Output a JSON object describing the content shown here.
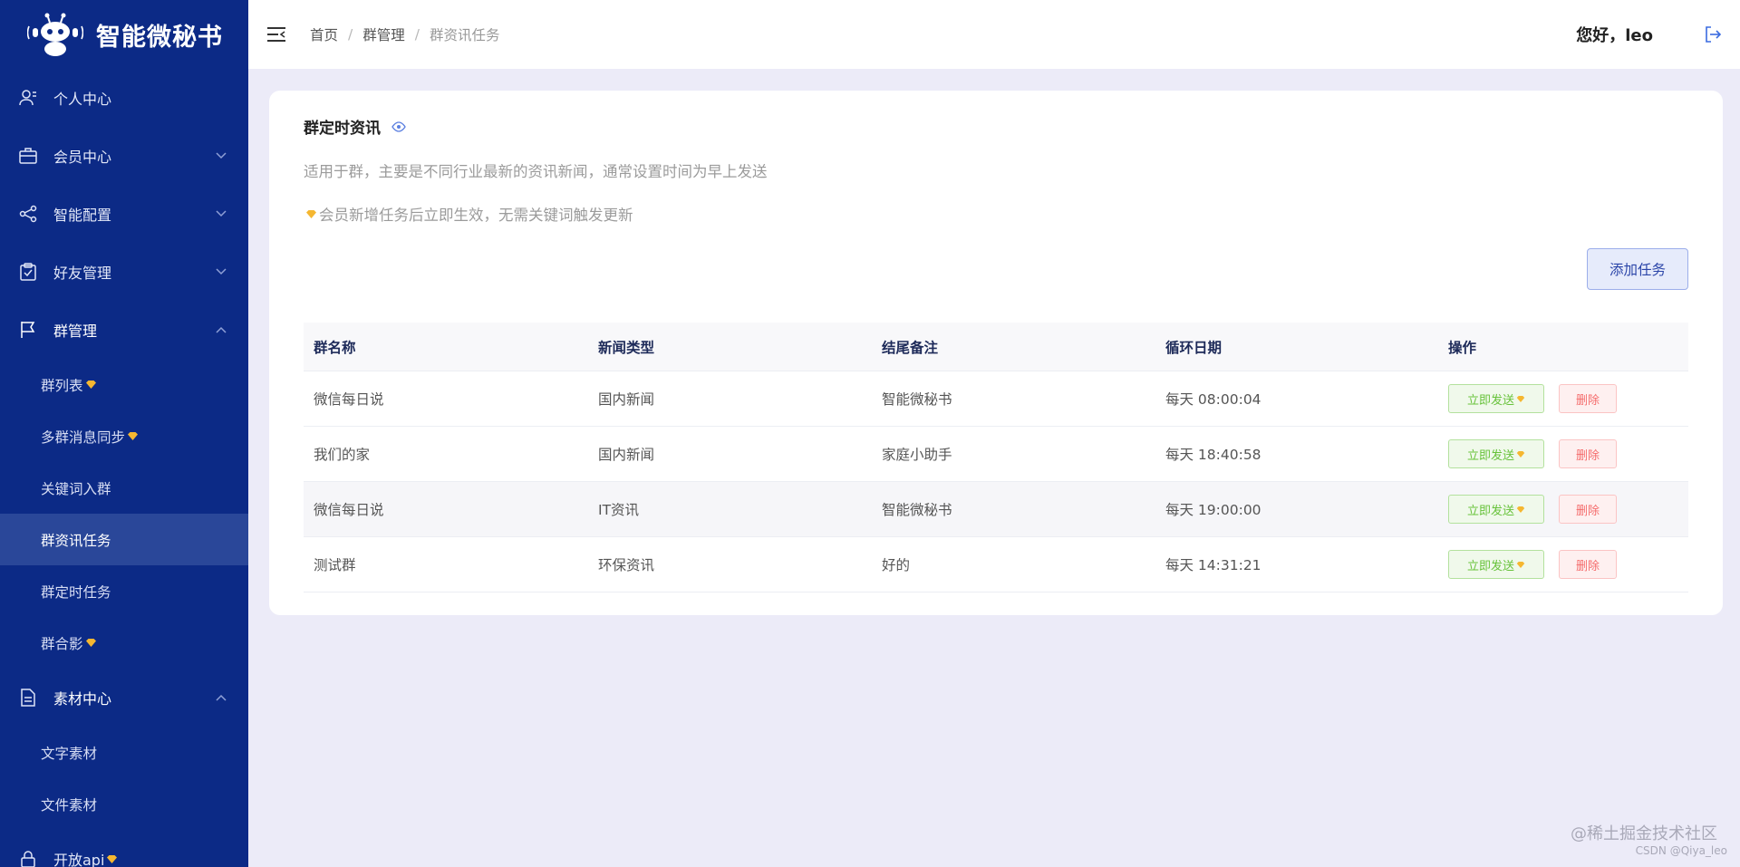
{
  "brand": {
    "name": "智能微秘书"
  },
  "sidebar": {
    "items": [
      {
        "label": "个人中心",
        "icon": "user-icon"
      },
      {
        "label": "会员中心",
        "icon": "briefcase-icon"
      },
      {
        "label": "智能配置",
        "icon": "share-icon"
      },
      {
        "label": "好友管理",
        "icon": "clipboard-check-icon"
      },
      {
        "label": "群管理",
        "icon": "flag-icon"
      }
    ],
    "group_sub": [
      {
        "label": "群列表",
        "gem": true
      },
      {
        "label": "多群消息同步",
        "gem": true
      },
      {
        "label": "关键词入群",
        "gem": false
      },
      {
        "label": "群资讯任务",
        "gem": false,
        "active": true
      },
      {
        "label": "群定时任务",
        "gem": false
      },
      {
        "label": "群合影",
        "gem": true
      }
    ],
    "material": {
      "label": "素材中心",
      "icon": "document-icon"
    },
    "material_sub": [
      {
        "label": "文字素材"
      },
      {
        "label": "文件素材"
      }
    ],
    "api": {
      "label": "开放api",
      "icon": "lock-icon"
    }
  },
  "header": {
    "breadcrumbs": [
      "首页",
      "群管理",
      "群资讯任务"
    ],
    "separator": "/",
    "greeting": "您好，leo"
  },
  "card": {
    "title": "群定时资讯",
    "desc1": "适用于群，主要是不同行业最新的资讯新闻，通常设置时间为早上发送",
    "desc2": "会员新增任务后立即生效，无需关键词触发更新",
    "add_button": "添加任务"
  },
  "table": {
    "headers": [
      "群名称",
      "新闻类型",
      "结尾备注",
      "循环日期",
      "操作"
    ],
    "rows": [
      {
        "name": "微信每日说",
        "type": "国内新闻",
        "note": "智能微秘书",
        "date": "每天 08:00:04"
      },
      {
        "name": "我们的家",
        "type": "国内新闻",
        "note": "家庭小助手",
        "date": "每天 18:40:58"
      },
      {
        "name": "微信每日说",
        "type": "IT资讯",
        "note": "智能微秘书",
        "date": "每天 19:00:00"
      },
      {
        "name": "测试群",
        "type": "环保资讯",
        "note": "好的",
        "date": "每天 14:31:21"
      }
    ],
    "send_label": "立即发送",
    "delete_label": "删除"
  },
  "watermark": {
    "main": "@稀土掘金技术社区",
    "sub": "CSDN @Qiya_leo"
  },
  "colors": {
    "sidebar": "#0c2a86",
    "active": "#2a4799",
    "background": "#ecebf8",
    "gem": "#f5b731"
  }
}
